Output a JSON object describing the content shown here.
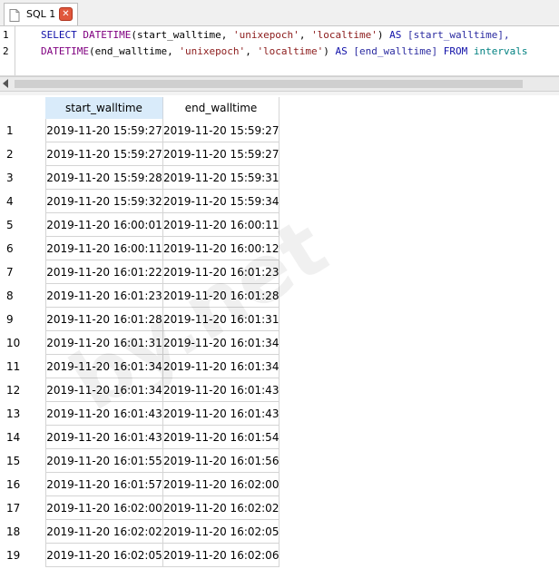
{
  "tab": {
    "label": "SQL 1",
    "icon": "sql-file-icon",
    "close_icon": "close-icon"
  },
  "editor": {
    "line_numbers": [
      "1",
      "2"
    ],
    "line1": {
      "kw_select": "SELECT",
      "fn_datetime": "DATETIME",
      "args_open": "(start_walltime, ",
      "s1": "'unixepoch'",
      "comma": ", ",
      "s2": "'localtime'",
      "close": ") ",
      "kw_as": "AS",
      "alias": " [start_walltime],"
    },
    "line2": {
      "fn_datetime": "DATETIME",
      "args_open": "(end_walltime, ",
      "s1": "'unixepoch'",
      "comma": ", ",
      "s2": "'localtime'",
      "close": ") ",
      "kw_as": "AS",
      "alias": " [end_walltime] ",
      "kw_from": "FROM",
      "table": " intervals"
    }
  },
  "results": {
    "columns": [
      "start_walltime",
      "end_walltime"
    ],
    "rows": [
      [
        "1",
        "2019-11-20 15:59:27",
        "2019-11-20 15:59:27"
      ],
      [
        "2",
        "2019-11-20 15:59:27",
        "2019-11-20 15:59:27"
      ],
      [
        "3",
        "2019-11-20 15:59:28",
        "2019-11-20 15:59:31"
      ],
      [
        "4",
        "2019-11-20 15:59:32",
        "2019-11-20 15:59:34"
      ],
      [
        "5",
        "2019-11-20 16:00:01",
        "2019-11-20 16:00:11"
      ],
      [
        "6",
        "2019-11-20 16:00:11",
        "2019-11-20 16:00:12"
      ],
      [
        "7",
        "2019-11-20 16:01:22",
        "2019-11-20 16:01:23"
      ],
      [
        "8",
        "2019-11-20 16:01:23",
        "2019-11-20 16:01:28"
      ],
      [
        "9",
        "2019-11-20 16:01:28",
        "2019-11-20 16:01:31"
      ],
      [
        "10",
        "2019-11-20 16:01:31",
        "2019-11-20 16:01:34"
      ],
      [
        "11",
        "2019-11-20 16:01:34",
        "2019-11-20 16:01:34"
      ],
      [
        "12",
        "2019-11-20 16:01:34",
        "2019-11-20 16:01:43"
      ],
      [
        "13",
        "2019-11-20 16:01:43",
        "2019-11-20 16:01:43"
      ],
      [
        "14",
        "2019-11-20 16:01:43",
        "2019-11-20 16:01:54"
      ],
      [
        "15",
        "2019-11-20 16:01:55",
        "2019-11-20 16:01:56"
      ],
      [
        "16",
        "2019-11-20 16:01:57",
        "2019-11-20 16:02:00"
      ],
      [
        "17",
        "2019-11-20 16:02:00",
        "2019-11-20 16:02:02"
      ],
      [
        "18",
        "2019-11-20 16:02:02",
        "2019-11-20 16:02:05"
      ],
      [
        "19",
        "2019-11-20 16:02:05",
        "2019-11-20 16:02:06"
      ]
    ]
  },
  "watermark": "by.net"
}
